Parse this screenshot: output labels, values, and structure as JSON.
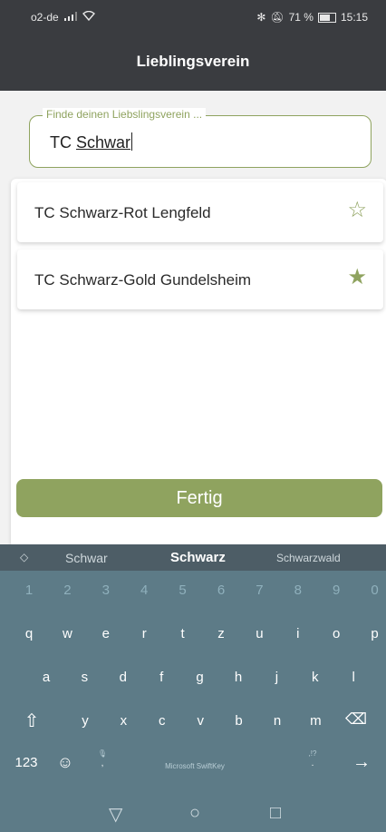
{
  "status_bar": {
    "carrier": "o2-de",
    "battery_text": "71 %",
    "battery_level": 0.71,
    "time": "15:15"
  },
  "header": {
    "title": "Lieblingsverein"
  },
  "search": {
    "label": "Finde deinen Liebslingsverein ...",
    "value_prefix": "TC ",
    "value_underlined": "Schwar"
  },
  "results": [
    {
      "name": "TC Schwarz-Rot Lengfeld",
      "favorite": false,
      "star": "☆"
    },
    {
      "name": "TC Schwarz-Gold Gundelsheim",
      "favorite": true,
      "star": "★"
    }
  ],
  "done_button": {
    "label": "Fertig"
  },
  "keyboard": {
    "suggestions": [
      "Schwar",
      "Schwarz",
      "Schwarzwald"
    ],
    "numbers": [
      "1",
      "2",
      "3",
      "4",
      "5",
      "6",
      "7",
      "8",
      "9",
      "0"
    ],
    "row1": [
      "q",
      "w",
      "e",
      "r",
      "t",
      "z",
      "u",
      "i",
      "o",
      "p"
    ],
    "row2": [
      "a",
      "s",
      "d",
      "f",
      "g",
      "h",
      "j",
      "k",
      "l"
    ],
    "row3": [
      "y",
      "x",
      "c",
      "v",
      "b",
      "n",
      "m"
    ],
    "numeric_label": "123",
    "brand": "Microsoft SwiftKey",
    "punct_label": ",",
    "punct_label2": ".",
    "punct_alt": ",!?"
  },
  "colors": {
    "accent": "#8fa35f",
    "header_bg": "#3a3c40",
    "keyboard_bg": "#5d7b87"
  },
  "icons": {
    "signal": "signal-icon",
    "wifi": "wifi-icon",
    "bluetooth": "bluetooth-icon",
    "mute": "mute-icon",
    "battery": "battery-icon",
    "shift": "shift-icon",
    "backspace": "backspace-icon",
    "emoji": "emoji-icon",
    "mic": "mic-icon",
    "enter": "enter-arrow-icon",
    "back": "nav-back-icon",
    "home": "nav-home-icon",
    "recents": "nav-recents-icon"
  }
}
